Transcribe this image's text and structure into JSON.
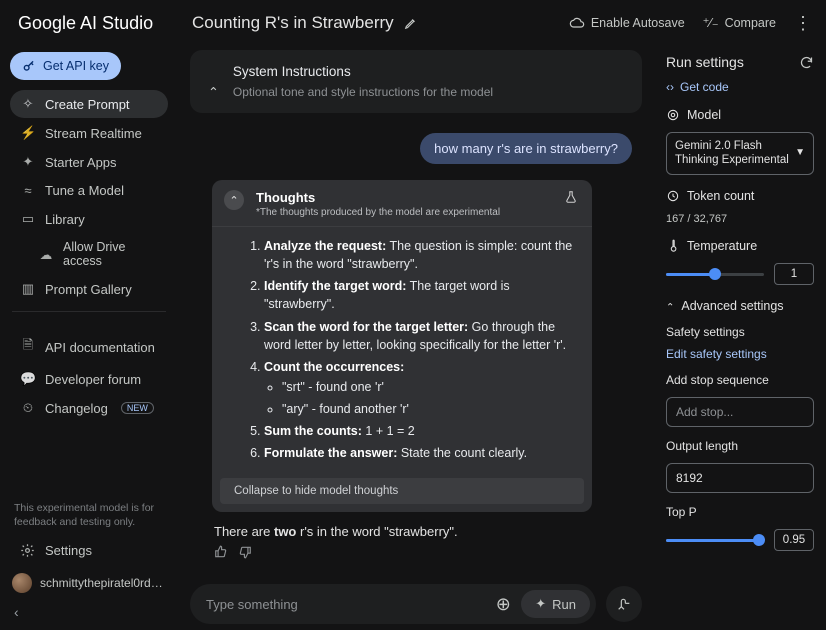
{
  "brand": "Google AI Studio",
  "prompt_title": "Counting R's in Strawberry",
  "topbar": {
    "autosave": "Enable Autosave",
    "compare": "Compare"
  },
  "sidebar": {
    "api_key": "Get API key",
    "items": [
      {
        "icon": "create-icon",
        "glyph": "✧",
        "label": "Create Prompt",
        "active": true
      },
      {
        "icon": "stream-icon",
        "glyph": "⚡",
        "label": "Stream Realtime"
      },
      {
        "icon": "starter-icon",
        "glyph": "✦",
        "label": "Starter Apps"
      },
      {
        "icon": "tune-icon",
        "glyph": "≈",
        "label": "Tune a Model"
      },
      {
        "icon": "library-icon",
        "glyph": "▭",
        "label": "Library"
      },
      {
        "icon": "drive-icon",
        "glyph": "☁",
        "label": "Allow Drive access",
        "sub": true
      },
      {
        "icon": "gallery-icon",
        "glyph": "▥",
        "label": "Prompt Gallery"
      }
    ],
    "items2": [
      {
        "icon": "docs-icon",
        "glyph": "🗎",
        "label": "API documentation"
      },
      {
        "icon": "forum-icon",
        "glyph": "💬",
        "label": "Developer forum"
      },
      {
        "icon": "changelog-icon",
        "glyph": "⏲",
        "label": "Changelog",
        "badge": "NEW"
      }
    ],
    "disclaimer": "This experimental model is for feedback and testing only.",
    "settings": "Settings",
    "username": "schmittythepiratel0rdoft..."
  },
  "system_instructions": {
    "title": "System Instructions",
    "subtitle": "Optional tone and style instructions for the model"
  },
  "user_message": "how many r's are in strawberry?",
  "thoughts": {
    "title": "Thoughts",
    "note": "*The thoughts produced by the model are experimental",
    "step1_b": "Analyze the request:",
    "step1_t": " The question is simple: count the 'r's in the word \"strawberry\".",
    "step2_b": "Identify the target word:",
    "step2_t": " The target word is \"strawberry\".",
    "step3_b": "Scan the word for the target letter:",
    "step3_t": " Go through the word letter by letter, looking specifically for the letter 'r'.",
    "step4_b": "Count the occurrences:",
    "step4_a": "\"srt\" - found one 'r'",
    "step4_bb": "\"ary\" - found another 'r'",
    "step5_b": "Sum the counts:",
    "step5_t": " 1 + 1 = 2",
    "step6_b": "Formulate the answer:",
    "step6_t": " State the count clearly.",
    "collapse": "Collapse to hide model thoughts"
  },
  "answer_pre": "There are ",
  "answer_bold": "two",
  "answer_post": " r's in the word \"strawberry\".",
  "composer": {
    "placeholder": "Type something",
    "run": "Run"
  },
  "run_settings": {
    "title": "Run settings",
    "get_code": "Get code",
    "model_label": "Model",
    "model_value": "Gemini 2.0 Flash Thinking Experimental",
    "token_label": "Token count",
    "token_value": "167 / 32,767",
    "temp_label": "Temperature",
    "temp_value": "1",
    "advanced": "Advanced settings",
    "safety_label": "Safety settings",
    "safety_edit": "Edit safety settings",
    "stop_label": "Add stop sequence",
    "stop_placeholder": "Add stop...",
    "out_label": "Output length",
    "out_value": "8192",
    "topp_label": "Top P",
    "topp_value": "0.95"
  }
}
